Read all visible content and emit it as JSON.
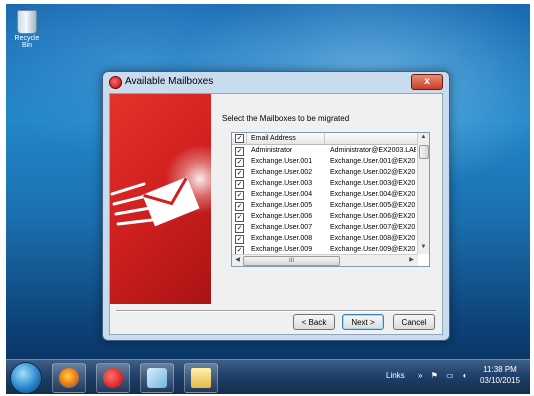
{
  "desktop": {
    "recycle_bin_label": "Recycle Bin"
  },
  "dialog": {
    "title": "Available Mailboxes",
    "close_glyph": "x",
    "prompt": "Select the Mailboxes to be migrated",
    "list": {
      "header_email": "Email Address",
      "header_address": "",
      "rows": [
        {
          "checked": true,
          "user": "Administrator",
          "address": "Administrator@EX2003.LAE"
        },
        {
          "checked": true,
          "user": "Exchange.User.001",
          "address": "Exchange.User.001@EX20"
        },
        {
          "checked": true,
          "user": "Exchange.User.002",
          "address": "Exchange.User.002@EX20"
        },
        {
          "checked": true,
          "user": "Exchange.User.003",
          "address": "Exchange.User.003@EX20"
        },
        {
          "checked": true,
          "user": "Exchange.User.004",
          "address": "Exchange.User.004@EX20"
        },
        {
          "checked": true,
          "user": "Exchange.User.005",
          "address": "Exchange.User.005@EX20"
        },
        {
          "checked": true,
          "user": "Exchange.User.006",
          "address": "Exchange.User.006@EX20"
        },
        {
          "checked": true,
          "user": "Exchange.User.007",
          "address": "Exchange.User.007@EX20"
        },
        {
          "checked": true,
          "user": "Exchange.User.008",
          "address": "Exchange.User.008@EX20"
        },
        {
          "checked": true,
          "user": "Exchange.User.009",
          "address": "Exchange.User.009@EX20"
        }
      ],
      "hscroll_grip": "III"
    },
    "buttons": {
      "back": "< Back",
      "next": "Next >",
      "cancel": "Cancel"
    }
  },
  "taskbar": {
    "links_label": "Links",
    "time": "11:38 PM",
    "date": "03/10/2015"
  },
  "colors": {
    "banner_red": "#cf1f1f",
    "desktop_blue": "#1b6fae"
  }
}
